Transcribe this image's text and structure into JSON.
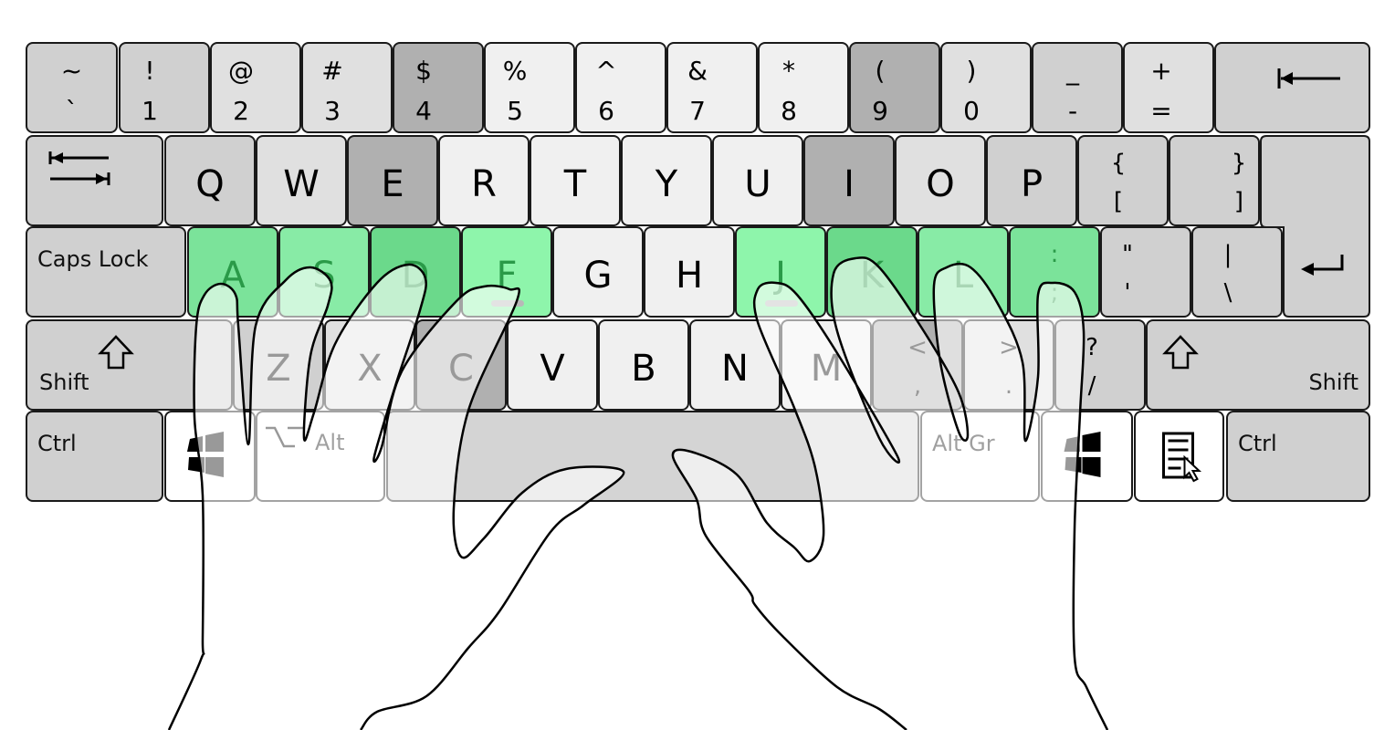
{
  "colors": {
    "pinky": "#d0d0d0",
    "ring": "#e0e0e0",
    "middle": "#b0b0b0",
    "index": "#f0f0f0",
    "white": "#ffffff",
    "space": "#d4d4d4",
    "home_green_a": "#7be39a",
    "home_green_s": "#88eba6",
    "home_green_d": "#6bd98b",
    "home_green_f": "#8ef5ab",
    "hand_fill": "rgba(255,255,255,0.6)",
    "outline": "#1a1a1a"
  },
  "keyboard": {
    "rows": [
      [
        {
          "id": "backtick",
          "top": "~",
          "bottom": "`",
          "color": "#d0d0d0"
        },
        {
          "id": "1",
          "top": "!",
          "bottom": "1",
          "color": "#d0d0d0"
        },
        {
          "id": "2",
          "top": "@",
          "bottom": "2",
          "color": "#e0e0e0"
        },
        {
          "id": "3",
          "top": "#",
          "bottom": "3",
          "color": "#e0e0e0"
        },
        {
          "id": "4",
          "top": "$",
          "bottom": "4",
          "color": "#b0b0b0"
        },
        {
          "id": "5",
          "top": "%",
          "bottom": "5",
          "color": "#f0f0f0"
        },
        {
          "id": "6",
          "top": "^",
          "bottom": "6",
          "color": "#f0f0f0"
        },
        {
          "id": "7",
          "top": "&",
          "bottom": "7",
          "color": "#f0f0f0"
        },
        {
          "id": "8",
          "top": "*",
          "bottom": "8",
          "color": "#f0f0f0"
        },
        {
          "id": "9",
          "top": "(",
          "bottom": "9",
          "color": "#b0b0b0"
        },
        {
          "id": "0",
          "top": ")",
          "bottom": "0",
          "color": "#e0e0e0"
        },
        {
          "id": "minus",
          "top": "_",
          "bottom": "-",
          "color": "#d0d0d0"
        },
        {
          "id": "equals",
          "top": "+",
          "bottom": "=",
          "color": "#e0e0e0"
        },
        {
          "id": "backspace",
          "icon": "backspace-icon",
          "color": "#d0d0d0"
        }
      ],
      [
        {
          "id": "tab",
          "icon": "tab-icon",
          "color": "#d0d0d0"
        },
        {
          "id": "q",
          "label": "Q",
          "color": "#d0d0d0"
        },
        {
          "id": "w",
          "label": "W",
          "color": "#e0e0e0"
        },
        {
          "id": "e",
          "label": "E",
          "color": "#b0b0b0"
        },
        {
          "id": "r",
          "label": "R",
          "color": "#f0f0f0"
        },
        {
          "id": "t",
          "label": "T",
          "color": "#f0f0f0"
        },
        {
          "id": "y",
          "label": "Y",
          "color": "#f0f0f0"
        },
        {
          "id": "u",
          "label": "U",
          "color": "#f0f0f0"
        },
        {
          "id": "i",
          "label": "I",
          "color": "#b0b0b0"
        },
        {
          "id": "o",
          "label": "O",
          "color": "#e0e0e0"
        },
        {
          "id": "p",
          "label": "P",
          "color": "#d0d0d0"
        },
        {
          "id": "lbracket",
          "top": "{",
          "bottom": "[",
          "color": "#d0d0d0"
        },
        {
          "id": "rbracket",
          "top": "}",
          "bottom": "]",
          "color": "#d0d0d0"
        },
        {
          "id": "enter",
          "icon": "enter-icon",
          "color": "#d0d0d0"
        }
      ],
      [
        {
          "id": "capslock",
          "label": "Caps Lock",
          "color": "#d0d0d0"
        },
        {
          "id": "a",
          "label": "A",
          "color": "#7be39a",
          "home": true
        },
        {
          "id": "s",
          "label": "S",
          "color": "#88eba6",
          "home": true
        },
        {
          "id": "d",
          "label": "D",
          "color": "#6bd98b",
          "home": true
        },
        {
          "id": "f",
          "label": "F",
          "color": "#8ef5ab",
          "home": true,
          "bump": true
        },
        {
          "id": "g",
          "label": "G",
          "color": "#f0f0f0"
        },
        {
          "id": "h",
          "label": "H",
          "color": "#f0f0f0"
        },
        {
          "id": "j",
          "label": "J",
          "color": "#8ef5ab",
          "home": true,
          "bump": true
        },
        {
          "id": "k",
          "label": "K",
          "color": "#6bd98b",
          "home": true
        },
        {
          "id": "l",
          "label": "L",
          "color": "#88eba6",
          "home": true
        },
        {
          "id": "semicolon",
          "top": ":",
          "bottom": ";",
          "color": "#7be39a",
          "home": true
        },
        {
          "id": "quote",
          "top": "\"",
          "bottom": "'",
          "color": "#d0d0d0"
        },
        {
          "id": "backslash",
          "top": "|",
          "bottom": "\\",
          "color": "#d0d0d0"
        }
      ],
      [
        {
          "id": "lshift",
          "label": "Shift",
          "icon": "shift-icon",
          "color": "#d0d0d0"
        },
        {
          "id": "z",
          "label": "Z",
          "color": "#d0d0d0"
        },
        {
          "id": "x",
          "label": "X",
          "color": "#e0e0e0"
        },
        {
          "id": "c",
          "label": "C",
          "color": "#b0b0b0"
        },
        {
          "id": "v",
          "label": "V",
          "color": "#f0f0f0"
        },
        {
          "id": "b",
          "label": "B",
          "color": "#f0f0f0"
        },
        {
          "id": "n",
          "label": "N",
          "color": "#f0f0f0"
        },
        {
          "id": "m",
          "label": "M",
          "color": "#f0f0f0"
        },
        {
          "id": "comma",
          "top": "<",
          "bottom": ",",
          "color": "#b0b0b0"
        },
        {
          "id": "period",
          "top": ">",
          "bottom": ".",
          "color": "#e0e0e0"
        },
        {
          "id": "slash",
          "top": "?",
          "bottom": "/",
          "color": "#d0d0d0"
        },
        {
          "id": "rshift",
          "label": "Shift",
          "icon": "shift-icon",
          "color": "#d0d0d0"
        }
      ],
      [
        {
          "id": "lctrl",
          "label": "Ctrl",
          "color": "#d0d0d0"
        },
        {
          "id": "lwin",
          "icon": "windows-icon",
          "color": "#ffffff"
        },
        {
          "id": "alt",
          "label": "Alt",
          "icon": "option-icon",
          "color": "#ffffff"
        },
        {
          "id": "space",
          "color": "#d4d4d4"
        },
        {
          "id": "altgr",
          "label": "Alt Gr",
          "color": "#ffffff"
        },
        {
          "id": "rwin",
          "icon": "windows-icon",
          "color": "#ffffff"
        },
        {
          "id": "menu",
          "icon": "menu-icon",
          "color": "#ffffff"
        },
        {
          "id": "rctrl",
          "label": "Ctrl",
          "color": "#d0d0d0"
        }
      ]
    ]
  },
  "hands": [
    {
      "side": "left",
      "icon": "left-hand-outline"
    },
    {
      "side": "right",
      "icon": "right-hand-outline"
    }
  ]
}
